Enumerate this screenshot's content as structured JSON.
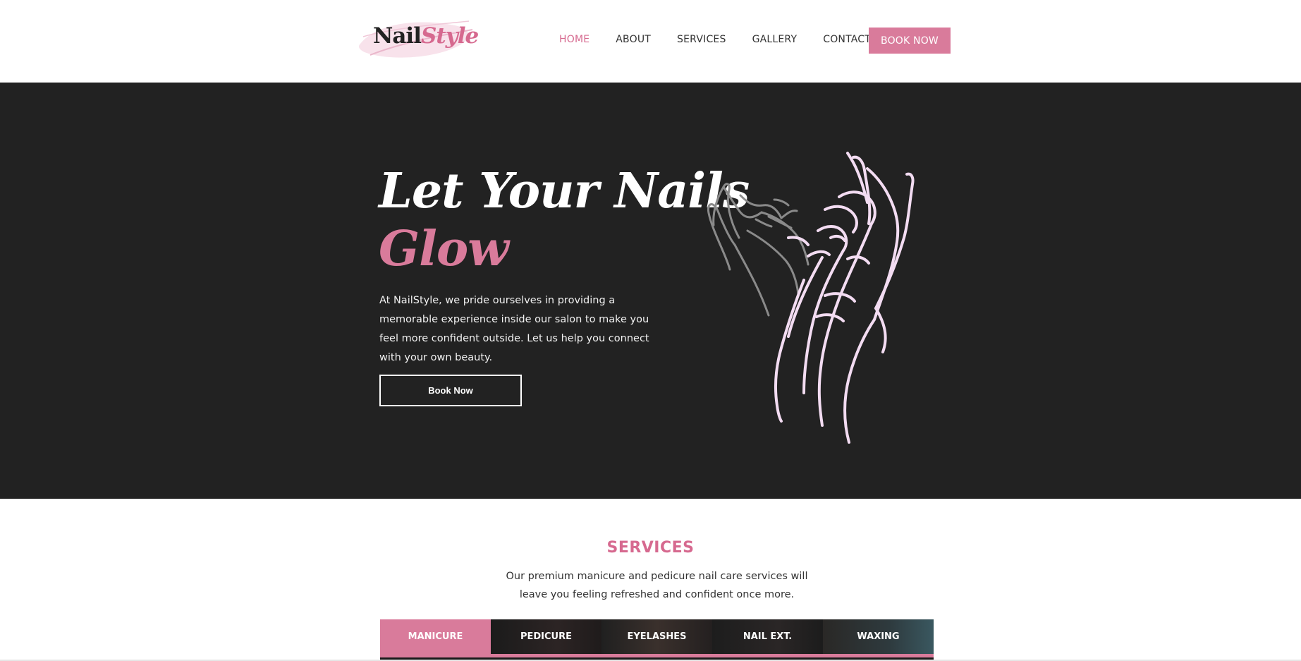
{
  "logo": {
    "part1": "Nail",
    "part2": "Style"
  },
  "nav": {
    "items": [
      {
        "label": "HOME"
      },
      {
        "label": "ABOUT"
      },
      {
        "label": "SERVICES"
      },
      {
        "label": "GALLERY"
      },
      {
        "label": "CONTACT"
      }
    ],
    "cta_label": "BOOK NOW"
  },
  "hero": {
    "title_line1": "Let Your Nails",
    "title_line2": "Glow",
    "description": "At NailStyle, we pride ourselves in providing a memorable experience inside our salon to make you feel more confident outside. Let us help you connect with your own beauty.",
    "button_label": "Book Now"
  },
  "services": {
    "title": "SERVICES",
    "description": "Our premium manicure and pedicure nail care services will leave you feeling refreshed and confident once more.",
    "tabs": [
      {
        "label": "MANICURE"
      },
      {
        "label": "PEDICURE"
      },
      {
        "label": "EYELASHES"
      },
      {
        "label": "NAIL EXT."
      },
      {
        "label": "WAXING"
      }
    ]
  },
  "colors": {
    "accent": "#d97b9b",
    "hero_bg": "#222222",
    "hand_outline": "#f3dcf2"
  }
}
